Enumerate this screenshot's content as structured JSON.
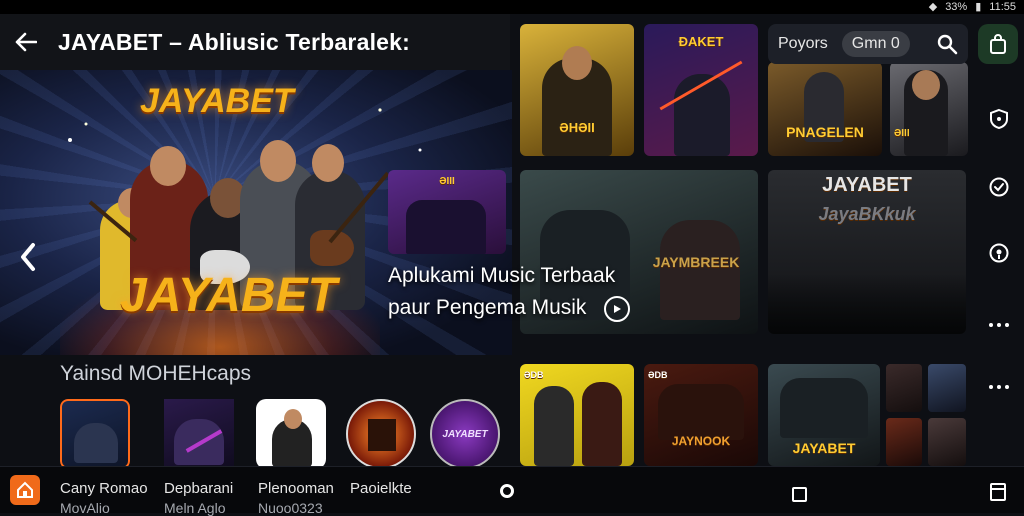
{
  "status_bar": {
    "battery": "33%",
    "time": "11:55"
  },
  "header": {
    "title": "JAYABET – Abliusic Terbaralek:"
  },
  "hero": {
    "brand_top": "JAYABET",
    "brand_bottom": "JAYABET"
  },
  "section": {
    "title": "Yainsd MOHEHcaps"
  },
  "featured": {
    "title": "Aplukami Music Terbaak",
    "subtitle": "paur Pengema Musik"
  },
  "filters": {
    "chip_1": "Poyors",
    "chip_2": "Gmn 0"
  },
  "tiles": {
    "t1_caption": "ƏHƏII",
    "t2_caption": "ĐAKET",
    "t3_caption": "PNAGELEN",
    "t4_caption": "ƏIII",
    "t5_caption": "ƏIII",
    "t6_caption": "JAYABET",
    "t6_sub": "JayaBKkuk",
    "t7_caption": "JAYMBREEK",
    "t8_caption": "JAYABET",
    "t9_caption": "JAYNOOK",
    "t10_caption": "ƏDB",
    "t11_caption": "ƏDB"
  },
  "icon_row": {
    "tile5_label": "JAYABET"
  },
  "bottom_nav": {
    "item_1": {
      "label": "Cany Romao",
      "sub": "MovAlio"
    },
    "item_2": {
      "label": "Depbarani",
      "sub": "Meln Aglo"
    },
    "item_3": {
      "label": "Plenooman",
      "sub": "Nuoo0323"
    },
    "item_4": {
      "label": "Paoielkte",
      "sub": ""
    }
  }
}
